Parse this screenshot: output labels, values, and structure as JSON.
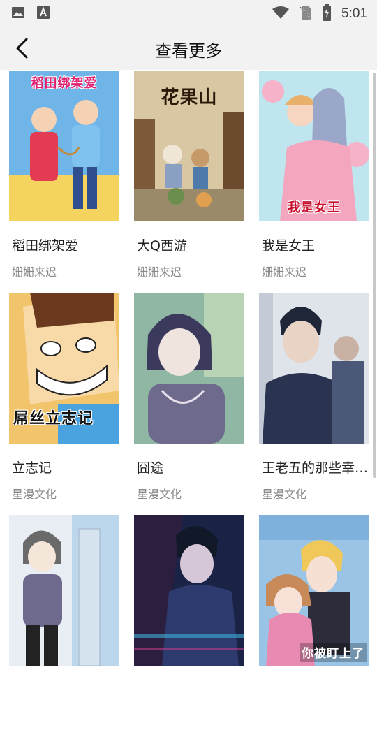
{
  "status_bar": {
    "time": "5:01",
    "left_icons": [
      "image-icon",
      "font-download-icon"
    ],
    "right_icons": [
      "wifi-icon",
      "no-sim-icon",
      "battery-charging-icon"
    ]
  },
  "header": {
    "title": "查看更多",
    "back_icon": "back-arrow-icon"
  },
  "comics": [
    {
      "title": "稻田绑架爱",
      "author": "姗姗来迟",
      "cover_text": "稻田绑架爱",
      "cover_colors": [
        "#6fb5e8",
        "#f4d35e",
        "#e23b52"
      ]
    },
    {
      "title": "大Q西游",
      "author": "姗姗来迟",
      "cover_text": "花果山",
      "cover_colors": [
        "#d8c7a2",
        "#7d5a3a",
        "#6b8e4e"
      ]
    },
    {
      "title": "我是女王",
      "author": "姗姗来迟",
      "cover_text": "我是女王",
      "cover_colors": [
        "#bfe6ee",
        "#f6b2c8",
        "#9aa7c9"
      ]
    },
    {
      "title": "立志记",
      "author": "星漫文化",
      "cover_text": "屌丝立志记",
      "cover_colors": [
        "#f8d9a8",
        "#f2c46b",
        "#4aa3df"
      ]
    },
    {
      "title": "囧途",
      "author": "星漫文化",
      "cover_text": "",
      "cover_colors": [
        "#8fb7a3",
        "#3c3a5c",
        "#c9b8c8"
      ]
    },
    {
      "title": "王老五的那些幸…",
      "author": "星漫文化",
      "cover_text": "",
      "cover_colors": [
        "#dfe3ea",
        "#2a3450",
        "#4b5877"
      ]
    },
    {
      "title": "",
      "author": "",
      "cover_text": "",
      "cover_colors": [
        "#bcd6ec",
        "#6d6a8e",
        "#e8eef3"
      ]
    },
    {
      "title": "",
      "author": "",
      "cover_text": "",
      "cover_colors": [
        "#1a2345",
        "#c23a8a",
        "#3fb0d8"
      ]
    },
    {
      "title": "",
      "author": "",
      "cover_text": "你被盯上了",
      "cover_colors": [
        "#9ac4e6",
        "#e98ab2",
        "#f0c85a"
      ]
    }
  ]
}
